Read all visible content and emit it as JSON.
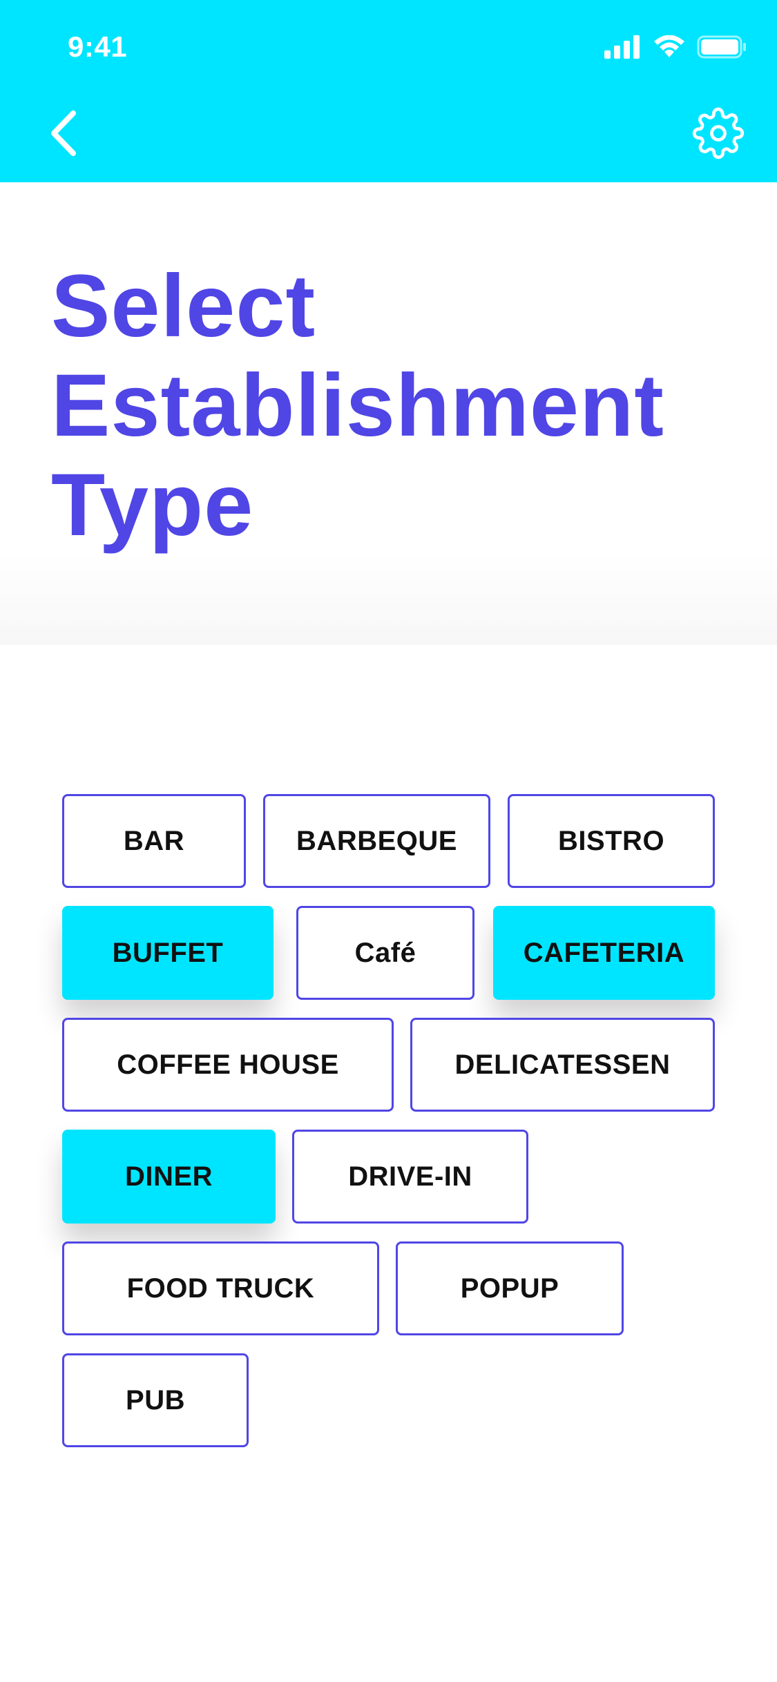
{
  "status_bar": {
    "time": "9:41",
    "icons": [
      "signal-icon",
      "wifi-icon",
      "battery-icon"
    ]
  },
  "nav": {
    "back_icon": "chevron-left-icon",
    "settings_icon": "gear-icon"
  },
  "page": {
    "title": "Select Establishment Type"
  },
  "establishment_types": [
    {
      "label": "BAR",
      "selected": false
    },
    {
      "label": "BARBEQUE",
      "selected": false
    },
    {
      "label": "BISTRO",
      "selected": false
    },
    {
      "label": "BUFFET",
      "selected": true
    },
    {
      "label": "Café",
      "selected": false
    },
    {
      "label": "CAFETERIA",
      "selected": true
    },
    {
      "label": "COFFEE HOUSE",
      "selected": false
    },
    {
      "label": "DELICATESSEN",
      "selected": false
    },
    {
      "label": "DINER",
      "selected": true
    },
    {
      "label": "DRIVE-IN",
      "selected": false
    },
    {
      "label": "FOOD TRUCK",
      "selected": false
    },
    {
      "label": "POPUP",
      "selected": false
    },
    {
      "label": "PUB",
      "selected": false
    }
  ],
  "colors": {
    "accent_cyan": "#00E5FF",
    "primary_purple": "#5046E5",
    "chip_text": "#111111",
    "background": "#FFFFFF"
  }
}
